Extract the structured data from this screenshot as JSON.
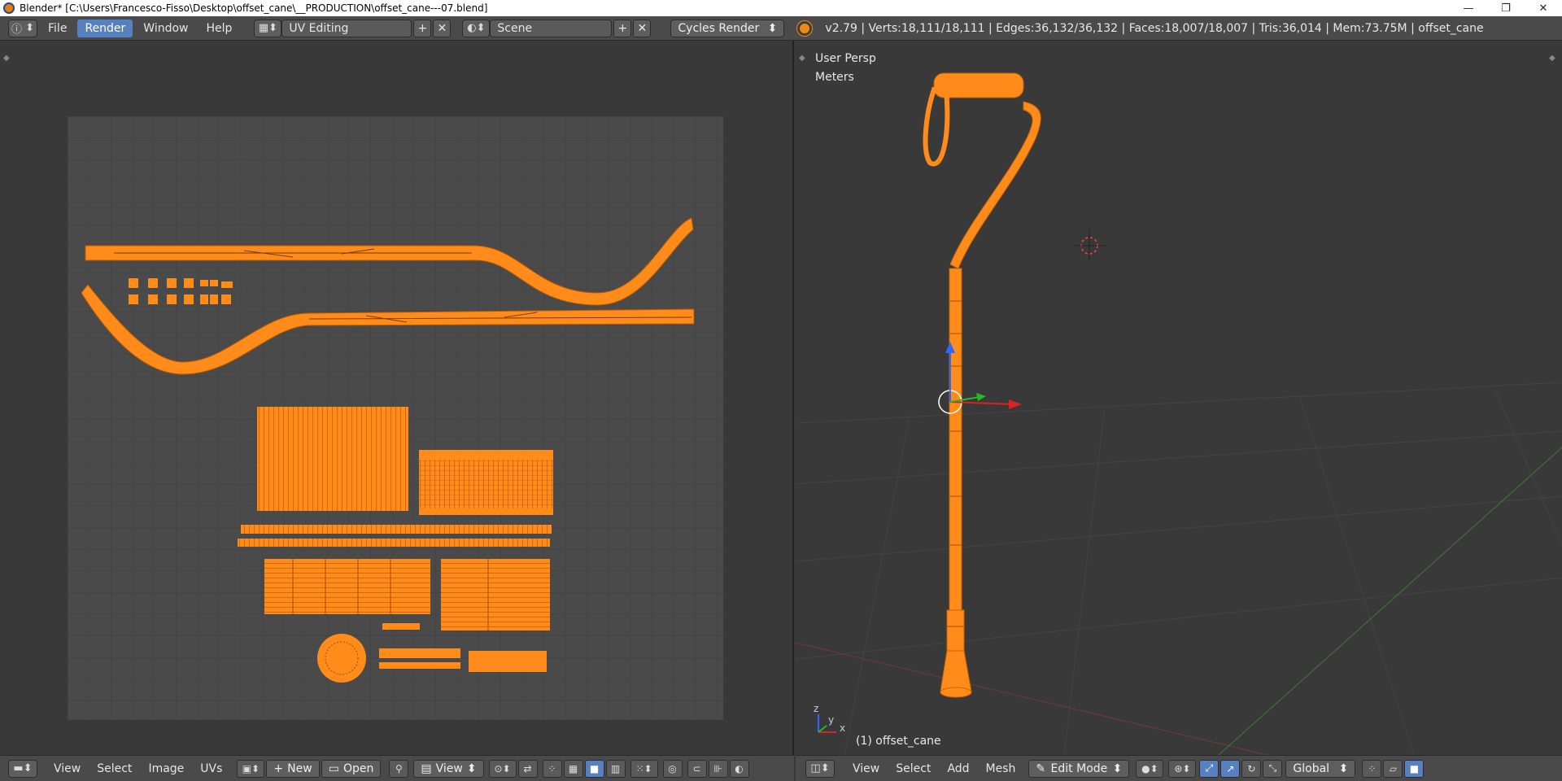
{
  "window": {
    "title": "Blender* [C:\\Users\\Francesco-Fisso\\Desktop\\offset_cane\\__PRODUCTION\\offset_cane---07.blend]",
    "minimize_glyph": "—",
    "maximize_glyph": "❐",
    "close_glyph": "✕"
  },
  "infobar": {
    "info_icon": "ⓘ",
    "menus": [
      "File",
      "Render",
      "Window",
      "Help"
    ],
    "active_menu": "Render",
    "screen_layout": "UV Editing",
    "scene": "Scene",
    "render_engine": "Cycles Render",
    "stats": "v2.79 | Verts:18,111/18,111 | Edges:36,132/36,132 | Faces:18,007/18,007 | Tris:36,014 | Mem:73.75M | offset_cane",
    "add_glyph": "+",
    "remove_glyph": "✕"
  },
  "uv_editor": {
    "menus": [
      "View",
      "Select",
      "Image",
      "UVs"
    ],
    "new_label": "New",
    "open_label": "Open",
    "view_label": "View",
    "uv_color": "#ff8c1a",
    "grid_bg": "#4a4a4a"
  },
  "viewport": {
    "view_name": "User Persp",
    "units": "Meters",
    "object_label": "(1) offset_cane",
    "menus": [
      "View",
      "Select",
      "Add",
      "Mesh"
    ],
    "mode": "Edit Mode",
    "orientation": "Global",
    "axis_y_label": "y",
    "axis_x_label": "x",
    "axis_z_label": "z"
  },
  "icons": {
    "editor_type": "uv-editor-icon",
    "viewport_editor": "3d-view-icon",
    "cursor": "3d-cursor-icon",
    "manipulator": "transform-manipulator-icon"
  },
  "colors": {
    "selection_orange": "#ff8c1a",
    "active_blue": "#5680c2",
    "header_bg": "#4a4a4a",
    "area_bg": "#393939"
  }
}
